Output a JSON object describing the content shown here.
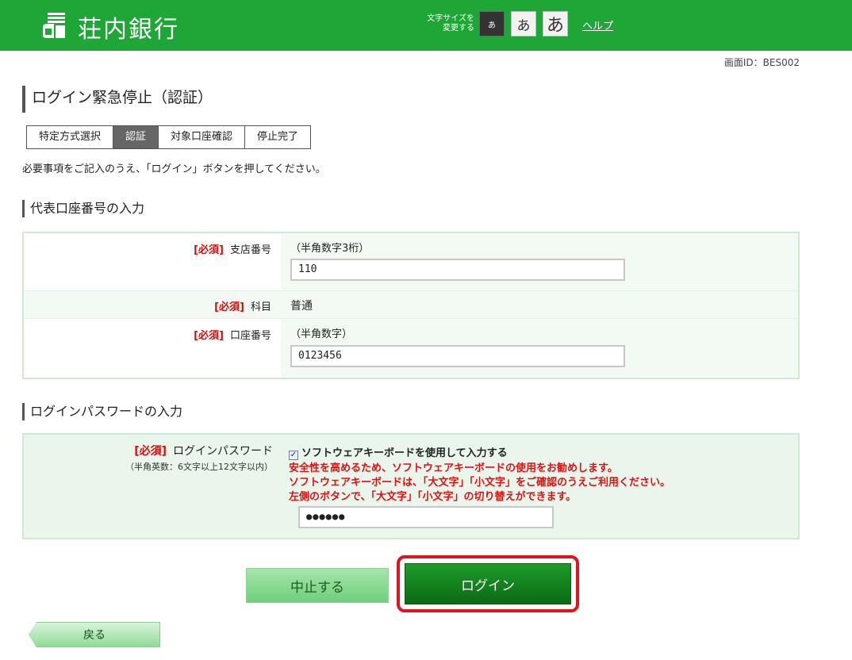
{
  "header": {
    "bank_name": "荘内銀行",
    "font_size_label_line1": "文字サイズを",
    "font_size_label_line2": "変更する",
    "font_size_small": "あ",
    "font_size_medium": "あ",
    "font_size_large": "あ",
    "help_label": "ヘルプ",
    "brand_color": "#1ea636"
  },
  "screen_id": "画面ID：BES002",
  "page_title": "ログイン緊急停止（認証）",
  "steps": [
    {
      "label": "特定方式選択",
      "active": false
    },
    {
      "label": "認証",
      "active": true
    },
    {
      "label": "対象口座確認",
      "active": false
    },
    {
      "label": "停止完了",
      "active": false
    }
  ],
  "instruction": "必要事項をご記入のうえ、「ログイン」ボタンを押してください。",
  "account_section": {
    "title": "代表口座番号の入力",
    "required_label": "[必須]",
    "branch": {
      "label": "支店番号",
      "hint": "（半角数字3桁）",
      "value": "110"
    },
    "subject": {
      "label": "科目",
      "value": "普通"
    },
    "account": {
      "label": "口座番号",
      "hint": "（半角数字）",
      "value": "0123456"
    }
  },
  "password_section": {
    "title": "ログインパスワードの入力",
    "required_label": "[必須]",
    "label": "ログインパスワード",
    "sub_label": "（半角英数：6文字以上12文字以内）",
    "checkbox_label": "ソフトウェアキーボードを使用して入力する",
    "checkbox_checked": true,
    "warning_1": "安全性を高めるため、ソフトウェアキーボードの使用をお勧めします。",
    "warning_2": "ソフトウェアキーボードは、「大文字」「小文字」をご確認のうえご利用ください。",
    "warning_3": "左側のボタンで、「大文字」「小文字」の切り替えができます。",
    "value": "●●●●●●"
  },
  "buttons": {
    "cancel": "中止する",
    "login": "ログイン",
    "back": "戻る"
  }
}
